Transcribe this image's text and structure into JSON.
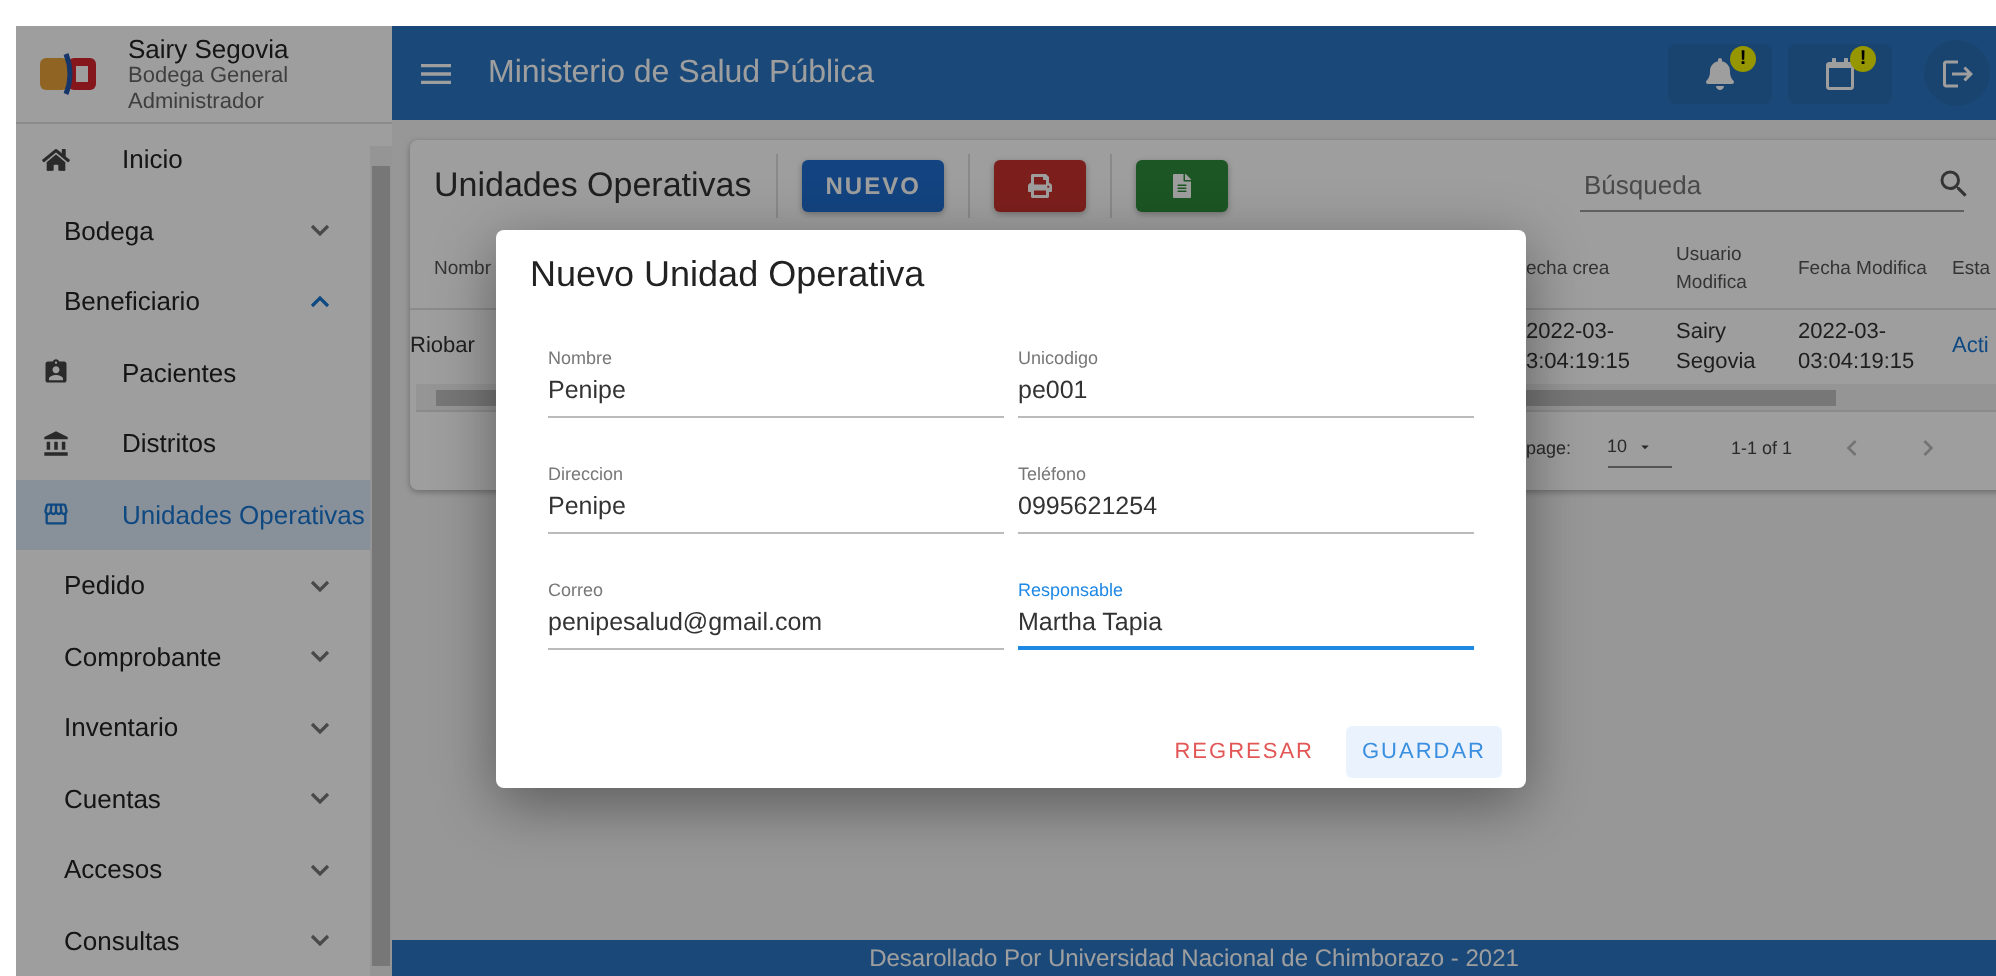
{
  "sidebar": {
    "user": {
      "name": "Sairy Segovia",
      "org": "Bodega General",
      "role": "Administrador"
    },
    "items": [
      {
        "label": "Inicio",
        "kind": "link",
        "selected": false
      },
      {
        "label": "Bodega",
        "kind": "group",
        "expanded": false
      },
      {
        "label": "Beneficiario",
        "kind": "group",
        "expanded": true,
        "children": [
          {
            "label": "Pacientes",
            "kind": "link",
            "selected": false
          },
          {
            "label": "Distritos",
            "kind": "link",
            "selected": false
          },
          {
            "label": "Unidades Operativas",
            "kind": "link",
            "selected": true
          }
        ]
      },
      {
        "label": "Pedido",
        "kind": "group",
        "expanded": false
      },
      {
        "label": "Comprobante",
        "kind": "group",
        "expanded": false
      },
      {
        "label": "Inventario",
        "kind": "group",
        "expanded": false
      },
      {
        "label": "Cuentas",
        "kind": "group",
        "expanded": false
      },
      {
        "label": "Accesos",
        "kind": "group",
        "expanded": false
      },
      {
        "label": "Consultas",
        "kind": "group",
        "expanded": false
      }
    ]
  },
  "header": {
    "title": "Ministerio de Salud Pública",
    "badges": [
      "!",
      "!"
    ]
  },
  "page": {
    "title": "Unidades Operativas",
    "new_button": "NUEVO",
    "search": {
      "placeholder": "Búsqueda"
    },
    "table": {
      "columns": [
        "Nombr",
        "echa crea",
        "Usuario Modifica",
        "Fecha Modifica",
        "Esta"
      ],
      "rows": [
        {
          "cells": [
            "Riobar",
            "2022-03- 3:04:19:15",
            "Sairy Segovia",
            "2022-03- 03:04:19:15",
            "Acti"
          ]
        }
      ]
    },
    "pagination": {
      "per_page_label": "page:",
      "per_page": "10",
      "range": "1-1 of 1"
    }
  },
  "dialog": {
    "title": "Nuevo Unidad Operativa",
    "fields": [
      {
        "label": "Nombre",
        "value": "Penipe",
        "focused": false
      },
      {
        "label": "Unicodigo",
        "value": "pe001",
        "focused": false
      },
      {
        "label": "Direccion",
        "value": "Penipe",
        "focused": false
      },
      {
        "label": "Teléfono",
        "value": "0995621254",
        "focused": false
      },
      {
        "label": "Correo",
        "value": "penipesalud@gmail.com",
        "focused": false
      },
      {
        "label": "Responsable",
        "value": "Martha Tapia",
        "focused": true
      }
    ],
    "buttons": [
      "REGRESAR",
      "GUARDAR"
    ]
  },
  "footer": "Desarollado Por Universidad Nacional de Chimborazo - 2021"
}
